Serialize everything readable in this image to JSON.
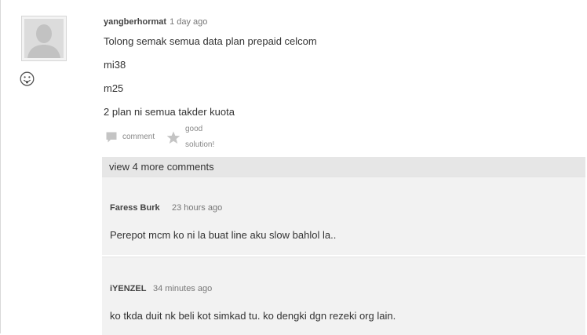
{
  "post": {
    "author": "yangberhormat",
    "time": "1 day ago",
    "lines": [
      "Tolong semak semua data plan prepaid celcom",
      "mi38",
      "m25",
      "2 plan ni semua takder kuota"
    ],
    "avatar_icon": "default-user-avatar",
    "mood_icon": "smiley-tongue-icon"
  },
  "actions": {
    "comment_label": "comment",
    "comment_icon": "speech-bubble-icon",
    "solution_label": "good solution!",
    "solution_icon": "star-icon"
  },
  "comments": {
    "view_more_label": "view 4 more comments",
    "items": [
      {
        "author": "Faress Burk",
        "time": "23 hours ago",
        "text": "Perepot mcm ko ni la buat line aku slow bahlol la.."
      },
      {
        "author": "iYENZEL",
        "time": "34 minutes ago",
        "text": "ko tkda duit nk beli kot simkad tu. ko dengki dgn rezeki org lain."
      }
    ]
  },
  "colors": {
    "panel": "#f2f2f2",
    "view_more_bg": "#e6e6e6",
    "icon_gray": "#c4c4c4"
  }
}
